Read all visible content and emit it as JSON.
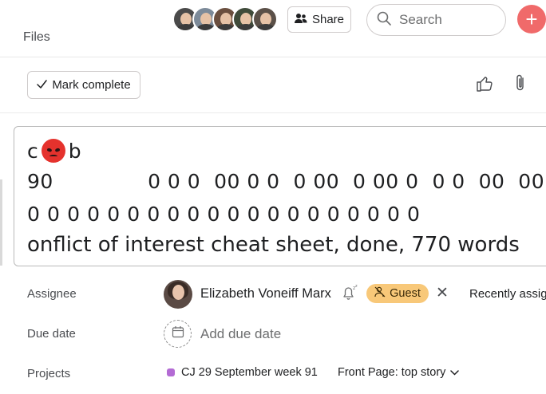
{
  "header": {
    "files_label": "Files",
    "share_label": "Share",
    "search_placeholder": "Search",
    "avatars": [
      {
        "name": "member-avatar-1",
        "color": "#4a4a4a"
      },
      {
        "name": "member-avatar-2",
        "color": "#7c8a99"
      },
      {
        "name": "member-avatar-3",
        "color": "#6b4f3f"
      },
      {
        "name": "member-avatar-4",
        "color": "#3f4b3a"
      },
      {
        "name": "member-avatar-5",
        "color": "#5b5048"
      }
    ],
    "accent": "#f06a6a"
  },
  "toolbar": {
    "mark_complete_label": "Mark complete"
  },
  "task": {
    "title_line_1_prefix": "c",
    "title_line_1_suffix": "b",
    "title_line_2": "90              0 0 0  00 0 0  0 00  0 00 0  0 0  00  00",
    "title_line_3": "0 0 0 0 0 0 0 0 0 0 0 0 0 0 0 0 0 0 0 0",
    "title_line_4": "onflict of interest cheat sheet, done, 770 words",
    "emoji": "angry-face"
  },
  "fields": {
    "assignee_label": "Assignee",
    "assignee_name": "Elizabeth Voneiff Marx",
    "guest_label": "Guest",
    "guest_color": "#f8c879",
    "remove_symbol": "✕",
    "recent_label": "Recently assig",
    "due_date_label": "Due date",
    "add_due_label": "Add due date",
    "projects_label": "Projects",
    "project_name": "CJ 29 September week 91",
    "project_color": "#b36bd4",
    "section_name": "Front Page: top story"
  }
}
